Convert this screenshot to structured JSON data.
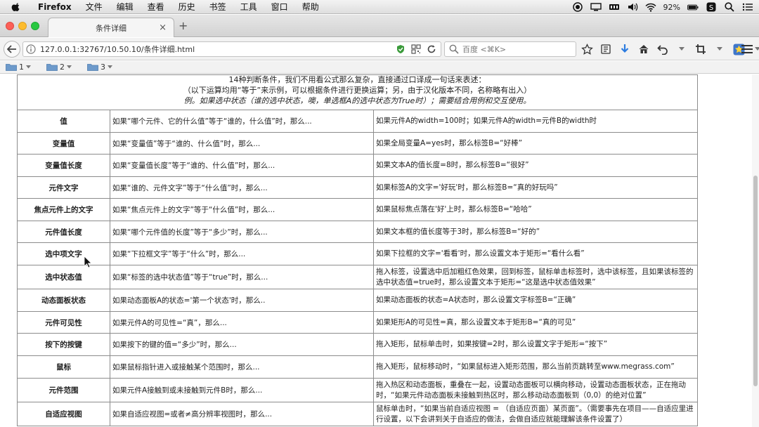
{
  "menubar": {
    "app_name": "Firefox",
    "items": [
      "文件",
      "编辑",
      "查看",
      "历史",
      "书签",
      "工具",
      "窗口",
      "帮助"
    ],
    "battery": "92%"
  },
  "tab": {
    "title": "条件详细"
  },
  "navbar": {
    "url": "127.0.0.1:32767/10.50.10/条件详细.html",
    "search_placeholder": "百度 <⌘K>"
  },
  "bookmarks": [
    {
      "label": "1"
    },
    {
      "label": "2"
    },
    {
      "label": "3"
    }
  ],
  "intro": {
    "line1": "14种判断条件，我们不用看公式那么复杂，直接通过口译成一句话来表述：",
    "line2": "（以下运算均用“等于”来示例，可以根据条件进行更换运算；另，由于汉化版本不同，名称略有出入）",
    "line3": "例。如果选中状态（谁的选中状态，噢，单选框A的选中状态为True时）；需要结合用例和交互使用。"
  },
  "conditions": [
    {
      "name": "值",
      "desc": "如果“哪个元件、它的什么值”等于“谁的，什么值”时，那么...",
      "example": "如果元件A的width=100时；如果元件A的width=元件B的width时"
    },
    {
      "name": "变量值",
      "desc": "如果“变量值”等于“谁的、什么值”时，那么...",
      "example": "如果全局变量A=yes时，那么标签B=“好棒”"
    },
    {
      "name": "变量值长度",
      "desc": "如果“变量值长度”等于“谁的、什么值”时，那么...",
      "example": "如果文本A的值长度=8时，那么标签B=“很好”"
    },
    {
      "name": "元件文字",
      "desc": "如果“谁的、元件文字”等于“什么值”时，那么...",
      "example": "如果标签A的文字='好玩'时，那么标签B=“真的好玩吗”"
    },
    {
      "name": "焦点元件上的文字",
      "desc": "如果“焦点元件上的文字”等于“什么值”时，那么...",
      "example": "如果鼠标焦点落在'好'上时，那么标签B=“哈哈”"
    },
    {
      "name": "元件值长度",
      "desc": "如果“哪个元件值的长度”等于“多少”时，那么...",
      "example": "如果文本框的值长度等于3时，那么标签B=“好的”"
    },
    {
      "name": "选中项文字",
      "desc": "如果“下拉框文字”等于“什么”时，那么...",
      "example": "如果下拉框的文字='看看'时，那么设置文本于矩形=“看什么看”"
    },
    {
      "name": "选中状态值",
      "desc": "如果“标签的选中状态值”等于“true”时，那么...",
      "example": "拖入标签，设置选中后加粗红色效果，回到标签，鼠标单击标签时，选中该标签，且如果该标签的选中状态值=true时，那么设置文本于矩形=“这是选中状态值效果”"
    },
    {
      "name": "动态面板状态",
      "desc": "如果动态面板A的状态='第一个状态'时，那么..",
      "example": "如果动态面板的状态=A状态时，那么设置文字标签B=“正确”"
    },
    {
      "name": "元件可见性",
      "desc": "如果元件A的可见性=“真”，那么...",
      "example": "如果矩形A的可见性=真，那么设置文本于矩形B=“真的可见”"
    },
    {
      "name": "按下的按键",
      "desc": "如果按下的键的值=“多少”时，那么...",
      "example": "拖入矩形，鼠标单击时，如果按键=2时，那么设置文字于矩形=“按下”"
    },
    {
      "name": "鼠标",
      "desc": "如果鼠标指针进入或接触某个范围时，那么...",
      "example": "拖入矩形，鼠标移动时，“如果鼠标进入矩形范围，那么当前页跳转至www.megrass.com”"
    },
    {
      "name": "元件范围",
      "desc": "如果元件A接触到或未接触到元件B时，那么...",
      "example": "拖入热区和动态面板，重叠在一起，设置动态面板可以横向移动，设置动态面板状态，正在拖动时，“如果元件动态面板未接触到热区时，那么移动动态面板到（0,0）的绝对位置”"
    },
    {
      "name": "自适应视图",
      "desc": "如果自适应视图=或者≠高分辨率视图时，那么...",
      "example": "鼠标单击时，“如果当前自适应视图 = （自适应页面）某页面”。（需要事先在项目——自适应里进行设置，以下会讲到关于自适应的做法，会做自适应就能理解该条件设置了）"
    }
  ]
}
